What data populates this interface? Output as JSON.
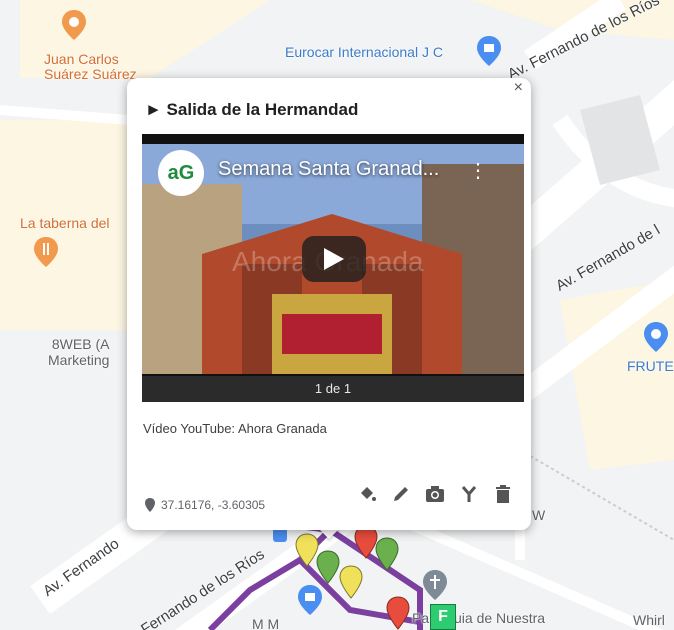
{
  "map": {
    "labels": {
      "poi_juan": "Juan Carlos\nSuárez Suárez",
      "poi_eurocar": "Eurocar Internacional J C",
      "poi_taberna": "La taberna del",
      "poi_8web": "8WEB (A\nMarketing",
      "poi_frute": "FRUTE",
      "road_rios_top": "Av. Fernando de los Ríos",
      "road_fernando_right": "Av. Fernando de l",
      "road_fernando_left": "Av. Fernando",
      "road_rios_bottom": "Fernando de los Ríos",
      "poi_parroquia": "Parroquia de Nuestra",
      "poi_whirl": "Whirl",
      "letter_w": "W",
      "poi_mm": "M M"
    },
    "marker_f_label": "F",
    "colors": {
      "route": "#7b3fa0",
      "marker_green": "#6ab04c",
      "marker_red": "#e74c3c",
      "marker_yellow": "#f1e05a",
      "marker_f": "#2ecc71"
    }
  },
  "popup": {
    "title": "► Salida de la Hermandad",
    "close_label": "×",
    "video": {
      "channel_logo": "aG",
      "title": "Semana Santa Granad...",
      "watermark": "Ahora Granada",
      "pager": "1 de 1"
    },
    "caption": "Vídeo YouTube: Ahora Granada",
    "coords": "37.16176, -3.60305",
    "toolbar": [
      "paint-bucket-icon",
      "pencil-icon",
      "camera-icon",
      "route-icon",
      "trash-icon"
    ]
  }
}
